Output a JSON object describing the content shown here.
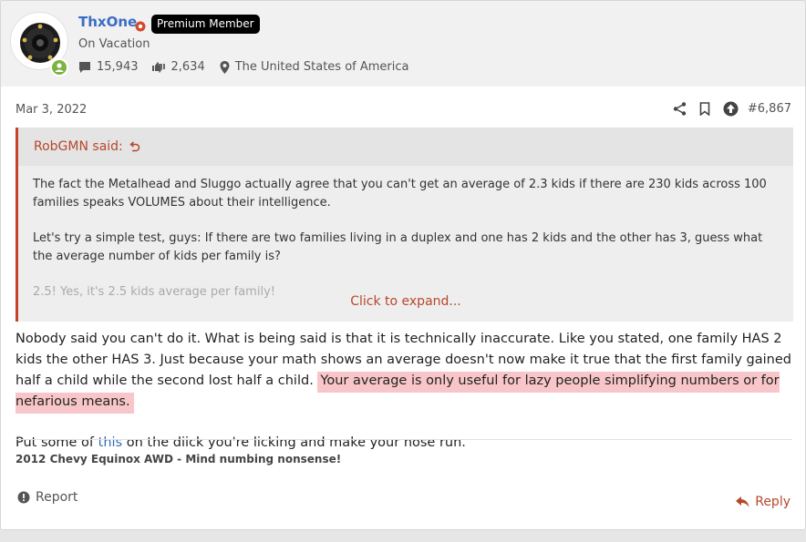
{
  "author": {
    "username": "ThxOne",
    "badge": "Premium Member",
    "title": "On Vacation",
    "messages": "15,943",
    "reactions": "2,634",
    "location": "The United States of America"
  },
  "post": {
    "date": "Mar 3, 2022",
    "number": "#6,867"
  },
  "quote": {
    "author_said": "RobGMN said:",
    "paragraph1": "The fact the Metalhead and Sluggo actually agree that you can't get an average of 2.3 kids if there are 230 kids across 100 families speaks VOLUMES about their intelligence.",
    "paragraph2": "Let's try a simple test, guys: If there are two families living in a duplex and one has 2 kids and the other has 3, guess what the average number of kids per family is?",
    "paragraph3": "2.5! Yes, it's 2.5 kids average per family!",
    "expand_label": "Click to expand..."
  },
  "message": {
    "text1": "Nobody said you can't do it. What is being said is that it is technically inaccurate. Like you stated, one family HAS 2 kids the other HAS 3. Just because your math shows an average doesn't now make it true that the first family gained half a child while the second lost half a child. ",
    "highlight": "Your average is only useful for lazy people simplifying numbers or for nefarious means.",
    "text2_prefix": "Put some of ",
    "link": "this",
    "text2_suffix": " on the diick you're licking and make your nose run."
  },
  "signature": "2012 Chevy Equinox AWD - Mind numbing nonsense!",
  "footer": {
    "report_label": "Report",
    "reply_label": "Reply"
  },
  "icons": [
    "messages-icon",
    "reactions-icon",
    "location-icon",
    "share-icon",
    "bookmark-icon",
    "upvote-icon",
    "jump-icon",
    "report-icon",
    "reply-icon",
    "staff-icon"
  ],
  "colors": {
    "username": "#3a6cc4",
    "accent": "#b7472a",
    "highlight": "#f8c6c8",
    "online": "#7cb342"
  }
}
